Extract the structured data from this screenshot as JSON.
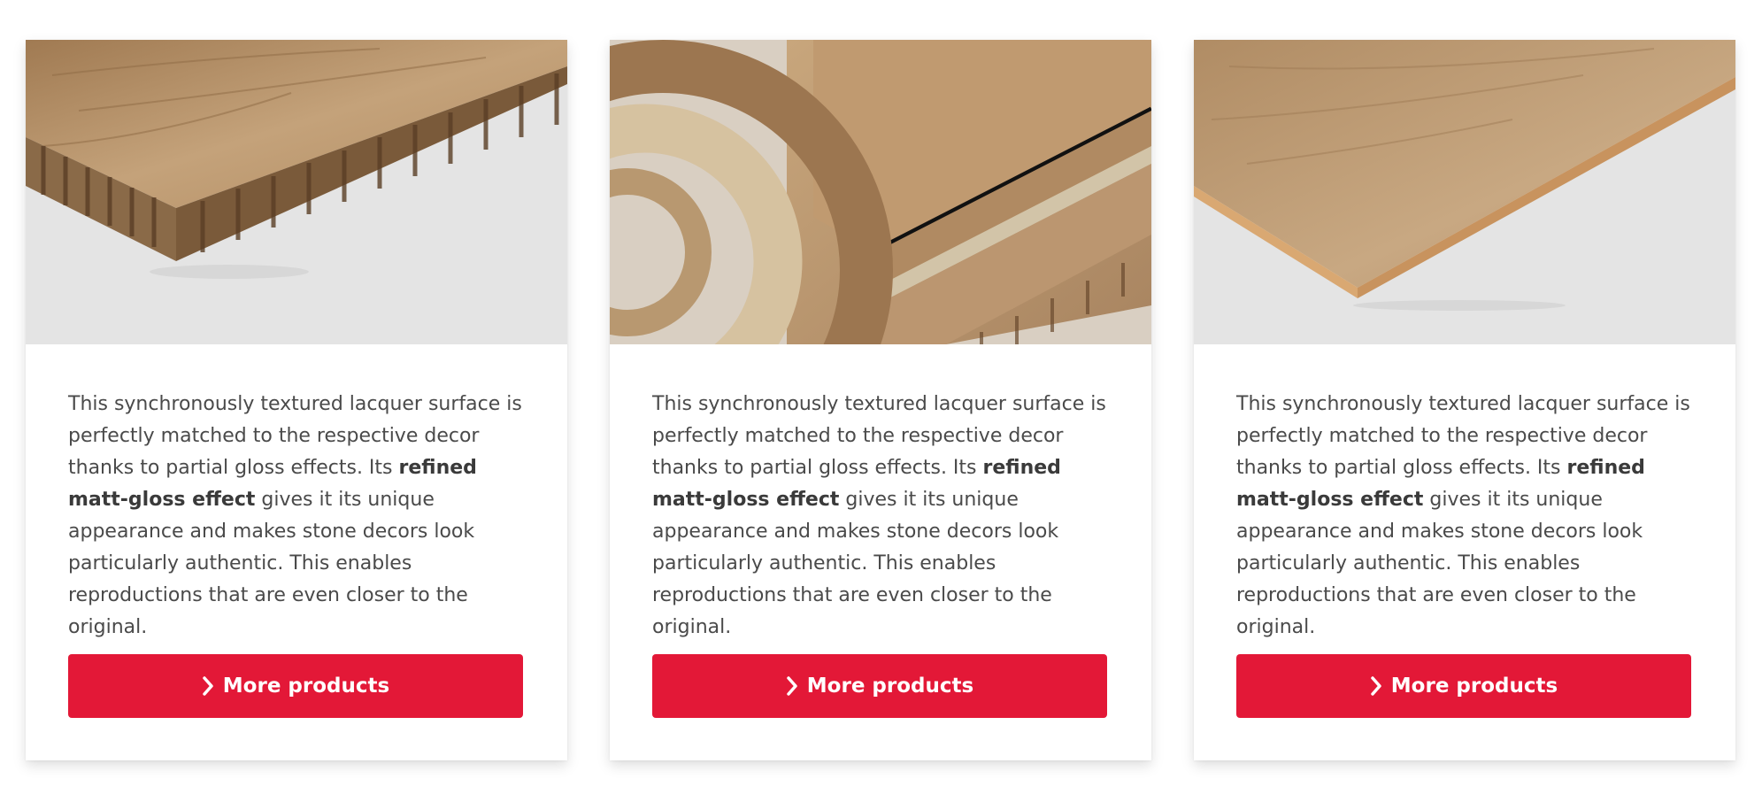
{
  "cards": [
    {
      "image_icon": "honeycomb-board-image",
      "text_before": "This synchronously textured lacquer surface is perfectly matched to the respective decor thanks to partial gloss effects. Its ",
      "text_bold": "refined matt-gloss effect",
      "text_after": " gives it its unique appearance and makes stone decors look particularly authentic. This enables reproductions that are even closer to the original.",
      "button_label": "More products",
      "button_icon": "chevron-right-icon"
    },
    {
      "image_icon": "stacked-boards-edgeband-image",
      "text_before": "This synchronously textured lacquer surface is perfectly matched to the respective decor thanks to partial gloss effects. Its ",
      "text_bold": "refined matt-gloss effect",
      "text_after": " gives it its unique appearance and makes stone decors look particularly authentic. This enables reproductions that are even closer to the original.",
      "button_label": "More products",
      "button_icon": "chevron-right-icon"
    },
    {
      "image_icon": "mdf-board-image",
      "text_before": "This synchronously textured lacquer surface is perfectly matched to the respective decor thanks to partial gloss effects. Its ",
      "text_bold": "refined matt-gloss effect",
      "text_after": " gives it its unique appearance and makes stone decors look particularly authentic. This enables reproductions that are even closer to the original.",
      "button_label": "More products",
      "button_icon": "chevron-right-icon"
    }
  ],
  "colors": {
    "button_bg": "#e31837",
    "button_text": "#ffffff",
    "body_text": "#4a4a4a",
    "image_bg": "#e4e4e4",
    "wood": "#b8946a"
  }
}
